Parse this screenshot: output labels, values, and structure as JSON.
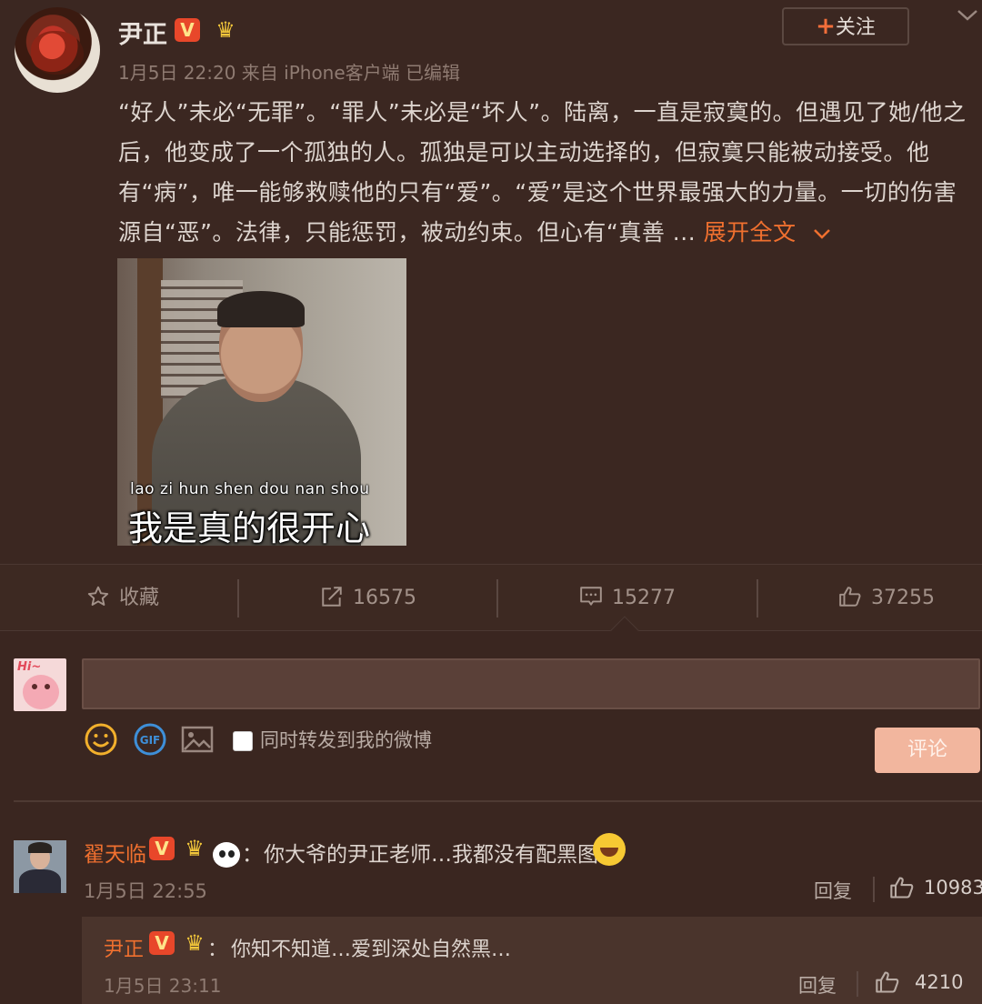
{
  "post": {
    "username": "尹正",
    "v_badge": "V",
    "meta": "1月5日 22:20 来自 iPhone客户端   已编辑",
    "follow_label": "关注",
    "body": "“好人”未必“无罪”。“罪人”未必是“坏人”。陆离，一直是寂寞的。但遇见了她/他之后，他变成了一个孤独的人。孤独是可以主动选择的，但寂寞只能被动接受。他有“病”，唯一能够救赎他的只有“爱”。“爱”是这个世界最强大的力量。一切的伤害源自“恶”。法律，只能惩罚，被动约束。但心有“真善 ... ",
    "expand_label": "展开全文",
    "image": {
      "subtitle_pinyin": "lao  zi  hun  shen dou  nan  shou",
      "subtitle_cn": "我是真的很开心"
    }
  },
  "actions": {
    "favorite_label": "收藏",
    "repost_count": "16575",
    "comment_count": "15277",
    "like_count": "37255"
  },
  "compose": {
    "input_value": "",
    "repost_checkbox_label": "同时转发到我的微博",
    "submit_label": "评论"
  },
  "comments": [
    {
      "username": "翟天临",
      "v_badge": "V",
      "text": "你大爷的尹正老师…我都没有配黑图",
      "time": "1月5日 22:55",
      "reply_label": "回复",
      "like_count": "10983"
    }
  ],
  "sub_comment": {
    "username": "尹正",
    "v_badge": "V",
    "text": "你知不知道…爱到深处自然黑…",
    "time": "1月5日 23:11",
    "reply_label": "回复",
    "like_count": "4210"
  },
  "colors": {
    "accent": "#f0702f",
    "background": "#3a2620",
    "vip_badge": "#e8472a"
  }
}
